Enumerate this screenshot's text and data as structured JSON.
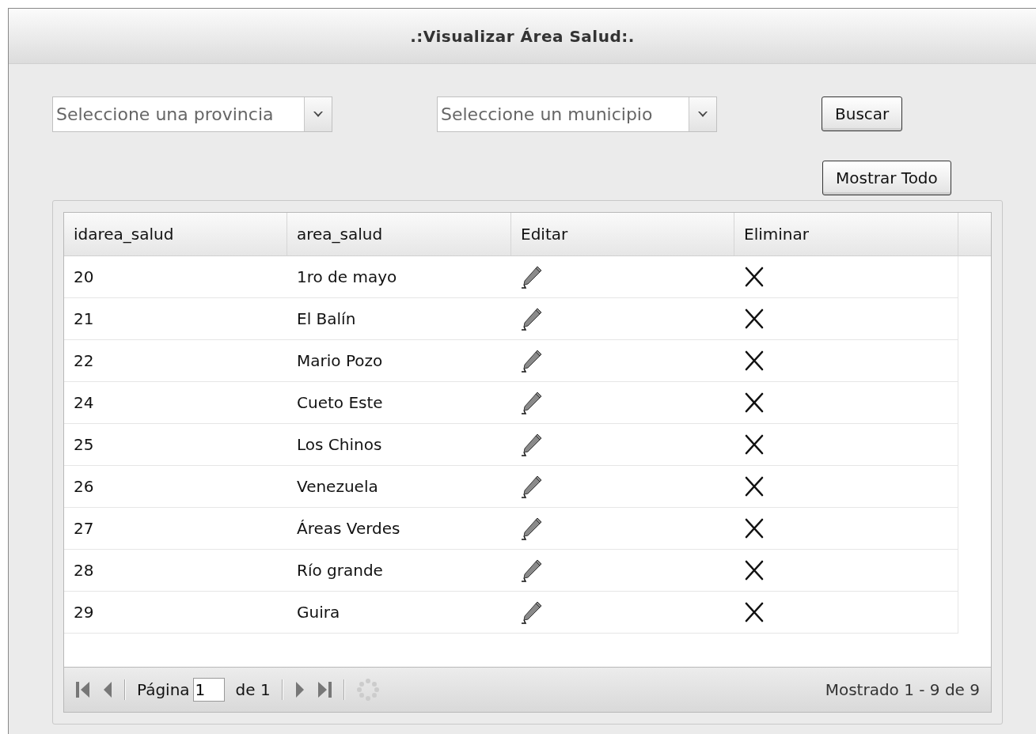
{
  "window": {
    "title": ".:Visualizar Área Salud:."
  },
  "filters": {
    "province": {
      "placeholder": "Seleccione una provincia"
    },
    "municipality": {
      "placeholder": "Seleccione un municipio"
    }
  },
  "buttons": {
    "search": "Buscar",
    "show_all": "Mostrar Todo"
  },
  "table": {
    "columns": [
      "idarea_salud",
      "area_salud",
      "Editar",
      "Eliminar"
    ],
    "rows": [
      {
        "idarea_salud": "20",
        "area_salud": "1ro de mayo"
      },
      {
        "idarea_salud": "21",
        "area_salud": "El Balín"
      },
      {
        "idarea_salud": "22",
        "area_salud": "Mario Pozo"
      },
      {
        "idarea_salud": "24",
        "area_salud": "Cueto Este"
      },
      {
        "idarea_salud": "25",
        "area_salud": "Los Chinos"
      },
      {
        "idarea_salud": "26",
        "area_salud": "Venezuela"
      },
      {
        "idarea_salud": "27",
        "area_salud": "Áreas Verdes"
      },
      {
        "idarea_salud": "28",
        "area_salud": "Río grande"
      },
      {
        "idarea_salud": "29",
        "area_salud": "Guira"
      }
    ]
  },
  "paging": {
    "page_label": "Página",
    "page": "1",
    "of_label": "de 1",
    "summary": "Mostrado 1 - 9 de 9"
  }
}
